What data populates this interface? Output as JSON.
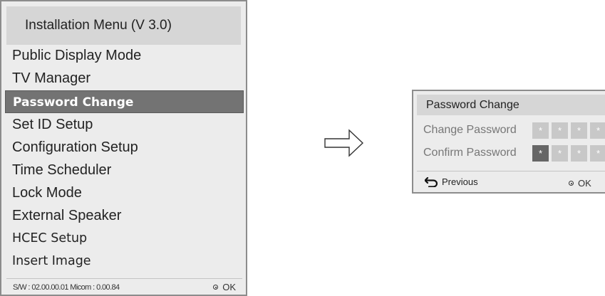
{
  "menu": {
    "title": "Installation Menu (V 3.0)",
    "items": [
      "Public Display Mode",
      "TV Manager",
      "Password Change",
      "Set ID Setup",
      "Configuration Setup",
      "Time Scheduler",
      "Lock Mode",
      "External Speaker",
      "HCEC Setup",
      "Insert Image"
    ],
    "selected_item": "Password Change",
    "footer_status": "S/W : 02.00.00.01 Micom : 0.00.84",
    "ok_label": "OK"
  },
  "arrow": {
    "icon": "right-arrow-icon"
  },
  "dialog": {
    "title": "Password Change",
    "change_password_label": "Change Password",
    "confirm_password_label": "Confirm Password",
    "change_boxes": [
      "*",
      "*",
      "*",
      "*"
    ],
    "confirm_boxes": [
      "*",
      "*",
      "*",
      "*"
    ],
    "previous_label": "Previous",
    "ok_label": "OK"
  },
  "colors": {
    "selected_bg": "#737373",
    "panel_bg": "#ececec",
    "header_bg": "#d6d6d6",
    "active_box": "#666666",
    "inactive_box": "#c8c8c8"
  }
}
